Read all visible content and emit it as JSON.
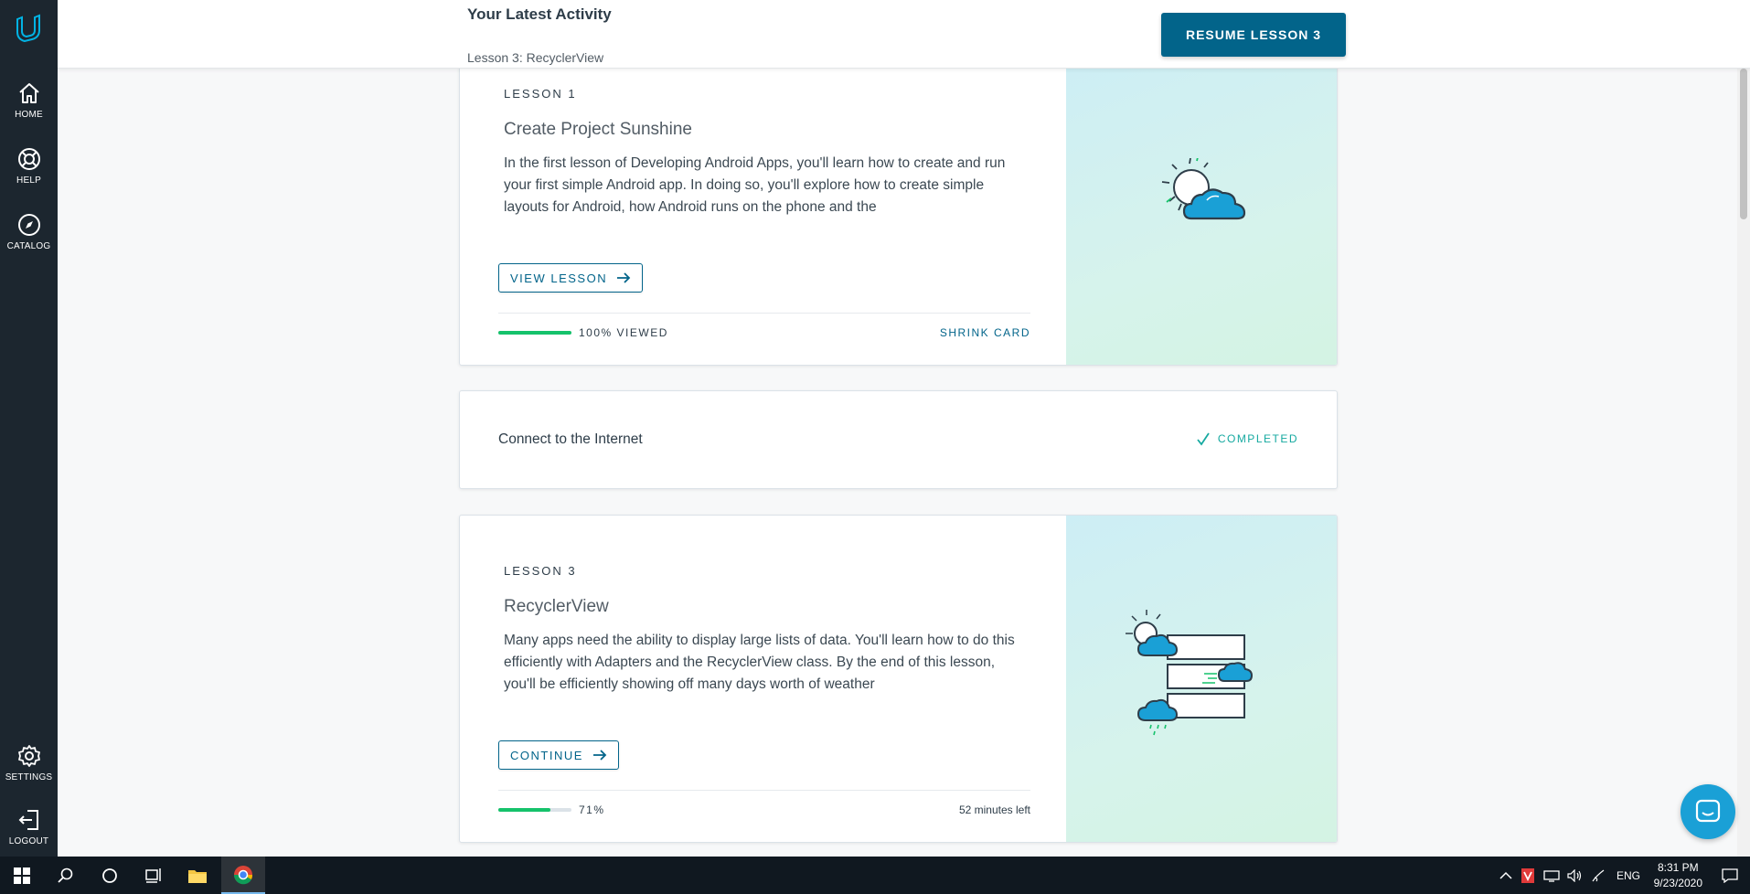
{
  "sidebar": {
    "logo_icon": "udacity-logo",
    "items": [
      {
        "label": "HOME",
        "icon": "home-icon"
      },
      {
        "label": "HELP",
        "icon": "help-icon"
      },
      {
        "label": "CATALOG",
        "icon": "compass-icon"
      },
      {
        "label": "SETTINGS",
        "icon": "gear-icon"
      },
      {
        "label": "LOGOUT",
        "icon": "logout-icon"
      }
    ]
  },
  "header": {
    "title": "Your Latest Activity",
    "subtitle": "Lesson 3: RecyclerView",
    "resume_label": "RESUME LESSON 3"
  },
  "cards": {
    "lesson1": {
      "label": "LESSON 1",
      "title": "Create Project Sunshine",
      "description": "In the first lesson of Developing Android Apps, you'll learn how to create and run your first simple Android app. In doing so, you'll explore how to create simple layouts for Android, how Android runs on the phone and the",
      "button": "VIEW LESSON",
      "progress": 1.0,
      "progress_text": "100% VIEWED",
      "shrink": "SHRINK CARD"
    },
    "concept": {
      "title": "Connect to the Internet",
      "status": "COMPLETED"
    },
    "lesson3": {
      "label": "LESSON 3",
      "title": "RecyclerView",
      "description": "Many apps need the ability to display large lists of data. You'll learn how to do this efficiently with Adapters and the RecyclerView class. By the end of this lesson, you'll be efficiently showing off many days worth of weather",
      "button": "CONTINUE",
      "progress": 0.71,
      "progress_text": "71%",
      "time_left": "52 minutes left"
    }
  },
  "taskbar": {
    "language": "ENG",
    "time": "8:31 PM",
    "date": "9/23/2020"
  },
  "colors": {
    "sidebar": "#1c262f",
    "accent": "#02648a",
    "progress": "#15c26b",
    "completed": "#15a9a0"
  }
}
